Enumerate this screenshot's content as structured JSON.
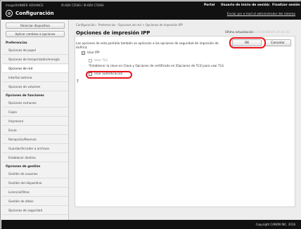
{
  "header": {
    "device_name": "imageRUNNER ADVANCE",
    "device_model": "iR-ADV C5560 / iR-ADV C5560i",
    "app_title": "Configuración",
    "portal_label": "Portal",
    "user_label": "Usuario de inicio de sesión:",
    "separator": "|",
    "logout_label": "Finalizar sesión",
    "email_admin_label": "Enviar por e-mail al administrador del sistema",
    "logo_icon": "brand-logo-icon"
  },
  "sidebar": {
    "restart_label": "Reiniciar dispositivo",
    "apply_label": "Aplicar cambios a opciones",
    "sections": [
      {
        "title": "Preferencias",
        "items": [
          "Opciones de papel",
          "Opciones de temporizador/energía",
          "Opciones de red",
          "Interfaz externa",
          "Opciones de volumen"
        ]
      },
      {
        "title": "Opciones de funciones",
        "items": [
          "Opciones comunes",
          "Copia",
          "Impresora",
          "Envío",
          "Recepción/Reenvío",
          "Guardar/Acceder a archivos",
          "Establecer destino"
        ]
      },
      {
        "title": "Opciones de gestión",
        "items": [
          "Gestión de usuarios",
          "Gestión del dispositivo",
          "Licencia/Otros",
          "Gestión de datos",
          "Opciones de seguridad"
        ]
      }
    ],
    "active_item": "Opciones de red"
  },
  "main": {
    "breadcrumb": "Configuración : Preferencias : Opciones de red > Opciones de impresión IPP",
    "title": "Opciones de impresión IPP",
    "last_update_label": "Última actualización :",
    "last_update_value": "2016/08/19 10:35:41",
    "ok_label": "OK",
    "cancel_label": "Cancelar",
    "description": "Las opciones de esta pantalla también se aplicarán a las opciones de seguridad de impresión de AirPrint.",
    "options": {
      "use_ipp": {
        "label": "Usar IPP",
        "checked": true
      },
      "use_tls": {
        "label": "Usar TLS",
        "checked": false
      },
      "tls_note": "*Establecer la clave en Clave y Opciones de certificado en [Opciones de TLS] para usar TLS.",
      "use_auth": {
        "label": "Usar autenticación",
        "checked": false
      }
    },
    "collapse_icon": "collapse-top-icon"
  },
  "footer": {
    "copyright": "Copyright CANON INC. 2016"
  },
  "colors": {
    "header_bg": "#111111",
    "highlight": "#e8141b",
    "panel_bg": "#ffffff"
  }
}
